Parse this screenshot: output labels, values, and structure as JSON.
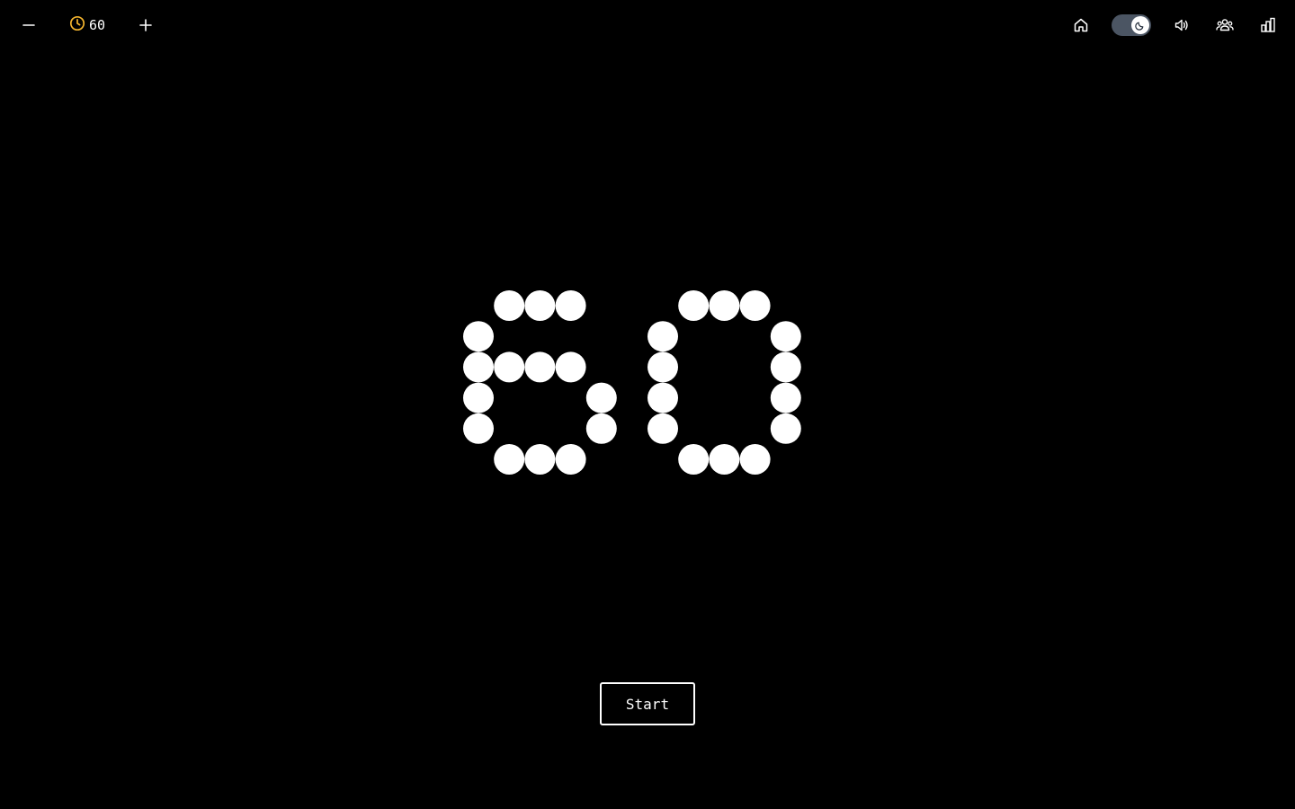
{
  "timer": {
    "value": "60",
    "accent_color": "#f5b52e"
  },
  "controls": {
    "decrease_icon": "minus-icon",
    "increase_icon": "plus-icon",
    "clock_icon": "clock-icon"
  },
  "nav": {
    "home_icon": "home-icon",
    "theme_toggle": "dark-mode",
    "theme_icon": "moon-icon",
    "sound_icon": "volume-icon",
    "multiplayer_icon": "users-icon",
    "stats_icon": "bar-chart-icon",
    "toggle_track_color": "#4b5563"
  },
  "display": {
    "digits": "60",
    "dot_color": "#ffffff",
    "background": "#000000"
  },
  "start_button": {
    "label": "Start"
  }
}
